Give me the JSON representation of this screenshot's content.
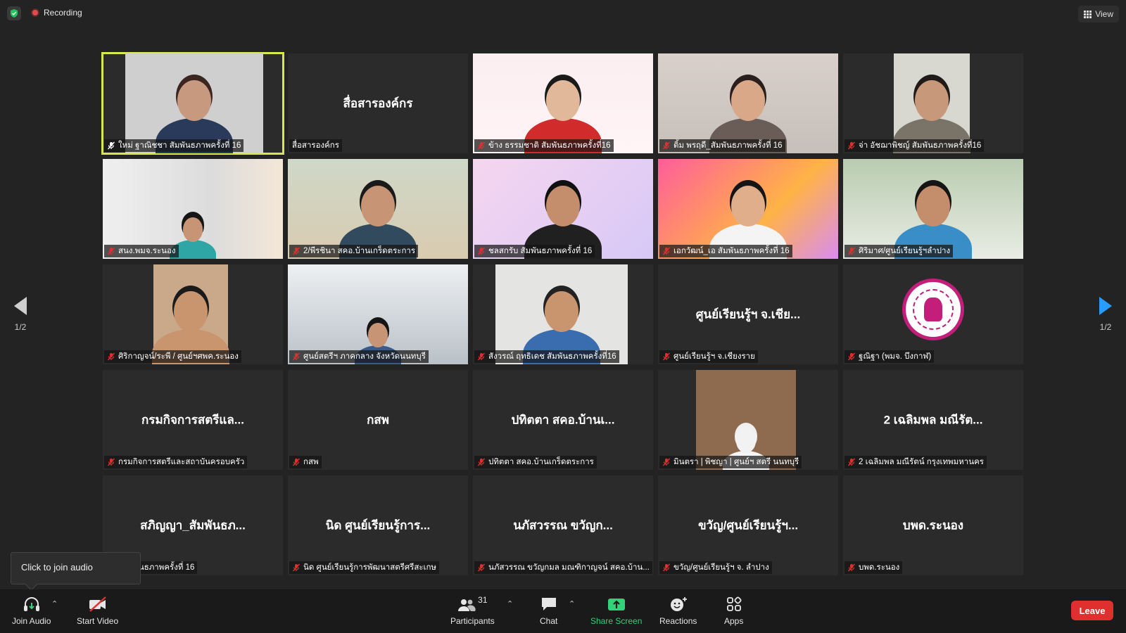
{
  "meeting": {
    "recording_label": "Recording",
    "view_label": "View"
  },
  "gallery": {
    "tiles": [
      {
        "name": "ใหม่ ฐาณิชชา สัมพันธภาพครั้งที่ 16",
        "display": "",
        "video": true,
        "active": true,
        "mic": "host"
      },
      {
        "name": "สื่อสารองค์กร",
        "display": "สื่อสารองค์กร",
        "video": false,
        "mic": "none"
      },
      {
        "name": "ข้าง ธรรมชาติ สัมพันธภาพครั้งที่16",
        "display": "",
        "video": true,
        "mic": "muted"
      },
      {
        "name": "ติ้ม พรฤดี_สัมพันธภาพครั้งที่ 16",
        "display": "",
        "video": true,
        "mic": "muted"
      },
      {
        "name": "จ่า อัชฌาพิชญ์ สัมพันธภาพครั้งที่16",
        "display": "",
        "video": true,
        "mic": "muted"
      },
      {
        "name": "สนง.พมจ.ระนอง",
        "display": "",
        "video": true,
        "mic": "muted"
      },
      {
        "name": "2/พีรชินา สคอ.บ้านเกร็ดตระการ",
        "display": "",
        "video": true,
        "mic": "muted"
      },
      {
        "name": "ชลสกรับ สัมพันธภาพครั้งที่ 16",
        "display": "",
        "video": true,
        "mic": "muted"
      },
      {
        "name": "เอกวัฒน์_เอ สัมพันธภาพครั้งที่ 16",
        "display": "",
        "video": true,
        "mic": "muted"
      },
      {
        "name": "ศิริมาศ/ศูนย์เรียนรู้ฯลำปาง",
        "display": "",
        "video": true,
        "mic": "muted"
      },
      {
        "name": "ศิริกาญจน์/ระพี / ศูนย์ฯศพค.ระนอง",
        "display": "",
        "video": true,
        "mic": "muted"
      },
      {
        "name": "ศูนย์สตรีฯ ภาคกลาง จังหวัดนนทบุรี",
        "display": "",
        "video": true,
        "mic": "muted"
      },
      {
        "name": "สังวรณ์ ฤทธิเดช สัมพันธภาพครั้งที่16",
        "display": "",
        "video": true,
        "mic": "muted"
      },
      {
        "name": "ศูนย์เรียนรู้ฯ จ.เชียงราย",
        "display": "ศูนย์เรียนรู้ฯ จ.เชีย...",
        "video": false,
        "mic": "muted"
      },
      {
        "name": "ฐณิฐา (พมจ. บึงกาฬ)",
        "display": "",
        "video": true,
        "mic": "muted"
      },
      {
        "name": "กรมกิจการสตรีและสถาบันครอบครัว",
        "display": "กรมกิจการสตรีแล...",
        "video": false,
        "mic": "muted"
      },
      {
        "name": "กสพ",
        "display": "กสพ",
        "video": false,
        "mic": "muted"
      },
      {
        "name": "ปทิตตา สคอ.บ้านเกร็ดตระการ",
        "display": "ปทิตตา สคอ.บ้านเ...",
        "video": false,
        "mic": "muted"
      },
      {
        "name": "มินตรา | พิชญา | ศูนย์ฯ สตรี นนทบุรี",
        "display": "",
        "video": true,
        "mic": "muted"
      },
      {
        "name": "2 เฉลิมพล มณีรัตน์ กรุงเทพมหานคร",
        "display": "2 เฉลิมพล มณีรัต...",
        "video": false,
        "mic": "muted"
      },
      {
        "name": "ญา_สัมพันธภาพครั้งที่ 16",
        "display": "สภิญญา_สัมพันธภ...",
        "video": false,
        "mic": "none"
      },
      {
        "name": "นิด ศูนย์เรียนรู้การพัฒนาสตรีศรีสะเกษ",
        "display": "นิด ศูนย์เรียนรู้การ...",
        "video": false,
        "mic": "muted"
      },
      {
        "name": "นภัสวรรณ ขวัญกมล มณฑิกาญจน์ สคอ.บ้าน...",
        "display": "นภัสวรรณ ขวัญก...",
        "video": false,
        "mic": "muted"
      },
      {
        "name": "ขวัญ/ศูนย์เรียนรู้ฯ จ. ลำปาง",
        "display": "ขวัญ/ศูนย์เรียนรู้ฯ...",
        "video": false,
        "mic": "muted"
      },
      {
        "name": "บพด.ระนอง",
        "display": "บพด.ระนอง",
        "video": false,
        "mic": "muted"
      }
    ]
  },
  "pager": {
    "left": "1/2",
    "right": "1/2"
  },
  "tooltip": {
    "text": "Click to join audio"
  },
  "toolbar": {
    "join_audio": "Join Audio",
    "start_video": "Start Video",
    "participants": "Participants",
    "participants_count": "31",
    "chat": "Chat",
    "share_screen": "Share Screen",
    "reactions": "Reactions",
    "apps": "Apps",
    "leave": "Leave"
  },
  "colors": {
    "background": "#232323",
    "tile": "#2b2b2b",
    "active_speaker": "#d8e84a",
    "share_green": "#33d17a",
    "leave_red": "#e02f2f",
    "nav_blue": "#2a9cff"
  }
}
